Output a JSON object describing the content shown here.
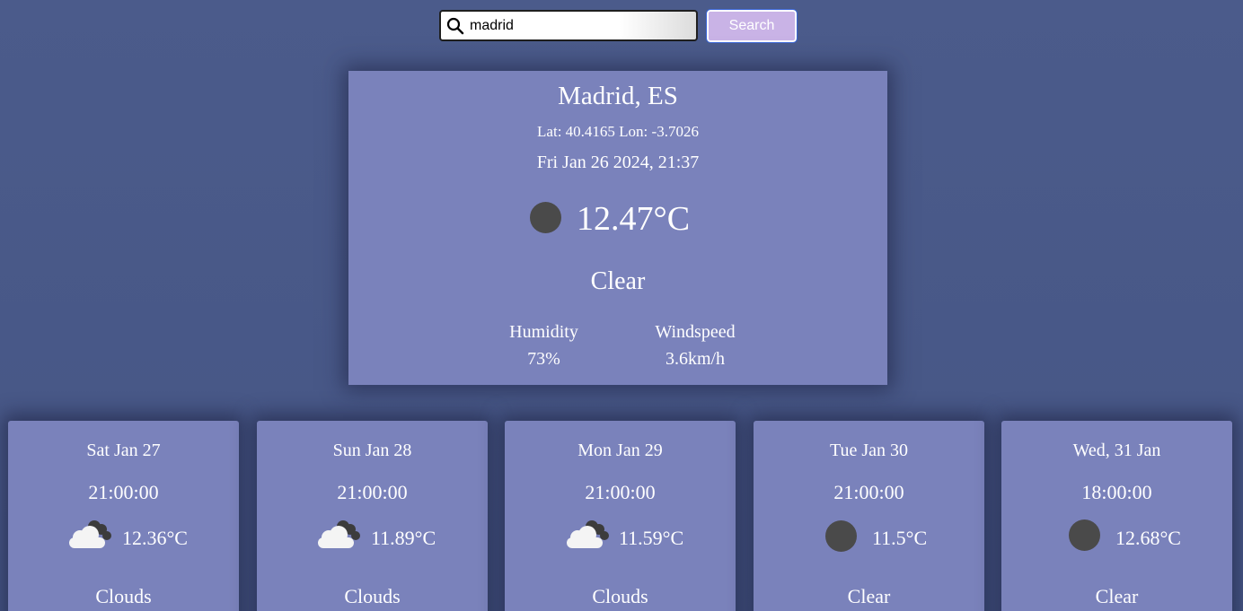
{
  "search": {
    "value": "madrid",
    "button_label": "Search",
    "icon": "search-icon"
  },
  "current": {
    "city": "Madrid, ES",
    "coords": "Lat: 40.4165 Lon: -3.7026",
    "datetime": "Fri Jan 26 2024, 21:37",
    "icon": "clear-night-icon",
    "temperature": "12.47°C",
    "condition": "Clear",
    "humidity_label": "Humidity",
    "humidity_value": "73%",
    "wind_label": "Windspeed",
    "wind_value": "3.6km/h"
  },
  "forecast": [
    {
      "day": "Sat Jan 27",
      "time": "21:00:00",
      "icon": "clouds-icon",
      "temp": "12.36°C",
      "condition": "Clouds"
    },
    {
      "day": "Sun Jan 28",
      "time": "21:00:00",
      "icon": "clouds-icon",
      "temp": "11.89°C",
      "condition": "Clouds"
    },
    {
      "day": "Mon Jan 29",
      "time": "21:00:00",
      "icon": "clouds-icon",
      "temp": "11.59°C",
      "condition": "Clouds"
    },
    {
      "day": "Tue Jan 30",
      "time": "21:00:00",
      "icon": "clear-night-icon",
      "temp": "11.5°C",
      "condition": "Clear"
    },
    {
      "day": "Wed, 31 Jan",
      "time": "18:00:00",
      "icon": "clear-night-icon",
      "temp": "12.68°C",
      "condition": "Clear"
    }
  ],
  "colors": {
    "background": "#4a5a8a",
    "card": "#7a82bb",
    "button": "#c9b3e6",
    "icon_dark": "#4a4a4a"
  }
}
